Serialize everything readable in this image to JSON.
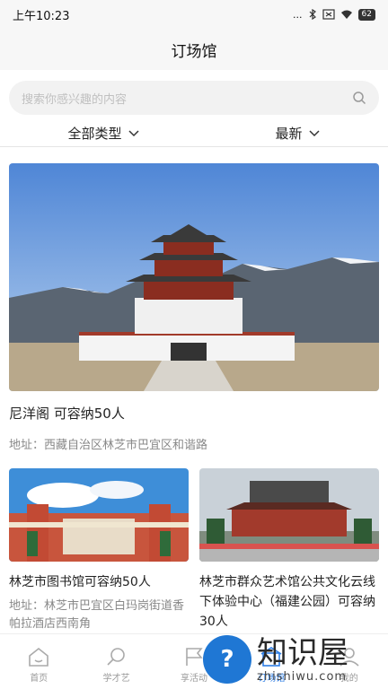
{
  "status_bar": {
    "time": "上午10:23",
    "signal": "...",
    "battery": "62"
  },
  "header": {
    "title": "订场馆"
  },
  "search": {
    "placeholder": "搜索你感兴趣的内容"
  },
  "filters": {
    "type_label": "全部类型",
    "sort_label": "最新"
  },
  "cards": [
    {
      "title": "尼洋阁 可容纳50人",
      "address": "地址：西藏自治区林芝市巴宜区和谐路"
    },
    {
      "title": "林芝市图书馆可容纳50人",
      "address": "地址：林芝市巴宜区白玛岗街道香帕拉酒店西南角"
    },
    {
      "title": "林芝市群众艺术馆公共文化云线下体验中心（福建公园）可容纳30人",
      "address": ""
    }
  ],
  "tabbar": {
    "items": [
      {
        "label": "首页",
        "icon": "home-icon"
      },
      {
        "label": "学才艺",
        "icon": "search-icon"
      },
      {
        "label": "享活动",
        "icon": "flag-icon"
      },
      {
        "label": "订场馆",
        "icon": "venue-icon",
        "active": true
      },
      {
        "label": "我的",
        "icon": "user-icon"
      }
    ]
  },
  "watermark": {
    "title": "知识屋",
    "url": "zhishiwu.com",
    "symbol": "?"
  },
  "colors": {
    "accent": "#2f7fe6",
    "watermark_blue": "#1f77d4"
  }
}
